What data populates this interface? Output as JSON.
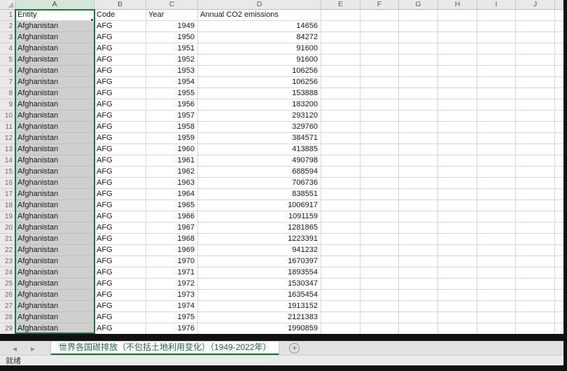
{
  "sheet": {
    "column_letters": [
      "A",
      "B",
      "C",
      "D",
      "E",
      "F",
      "G",
      "H",
      "I",
      "J"
    ],
    "header_row": {
      "entity": "Entity",
      "code": "Code",
      "year": "Year",
      "emissions": "Annual CO2 emissions"
    },
    "rows": [
      {
        "entity": "Afghanistan",
        "code": "AFG",
        "year": "1949",
        "value": "14656"
      },
      {
        "entity": "Afghanistan",
        "code": "AFG",
        "year": "1950",
        "value": "84272"
      },
      {
        "entity": "Afghanistan",
        "code": "AFG",
        "year": "1951",
        "value": "91600"
      },
      {
        "entity": "Afghanistan",
        "code": "AFG",
        "year": "1952",
        "value": "91600"
      },
      {
        "entity": "Afghanistan",
        "code": "AFG",
        "year": "1953",
        "value": "106256"
      },
      {
        "entity": "Afghanistan",
        "code": "AFG",
        "year": "1954",
        "value": "106256"
      },
      {
        "entity": "Afghanistan",
        "code": "AFG",
        "year": "1955",
        "value": "153888"
      },
      {
        "entity": "Afghanistan",
        "code": "AFG",
        "year": "1956",
        "value": "183200"
      },
      {
        "entity": "Afghanistan",
        "code": "AFG",
        "year": "1957",
        "value": "293120"
      },
      {
        "entity": "Afghanistan",
        "code": "AFG",
        "year": "1958",
        "value": "329760"
      },
      {
        "entity": "Afghanistan",
        "code": "AFG",
        "year": "1959",
        "value": "384571"
      },
      {
        "entity": "Afghanistan",
        "code": "AFG",
        "year": "1960",
        "value": "413885"
      },
      {
        "entity": "Afghanistan",
        "code": "AFG",
        "year": "1961",
        "value": "490798"
      },
      {
        "entity": "Afghanistan",
        "code": "AFG",
        "year": "1962",
        "value": "688594"
      },
      {
        "entity": "Afghanistan",
        "code": "AFG",
        "year": "1963",
        "value": "706736"
      },
      {
        "entity": "Afghanistan",
        "code": "AFG",
        "year": "1964",
        "value": "838551"
      },
      {
        "entity": "Afghanistan",
        "code": "AFG",
        "year": "1965",
        "value": "1006917"
      },
      {
        "entity": "Afghanistan",
        "code": "AFG",
        "year": "1966",
        "value": "1091159"
      },
      {
        "entity": "Afghanistan",
        "code": "AFG",
        "year": "1967",
        "value": "1281865"
      },
      {
        "entity": "Afghanistan",
        "code": "AFG",
        "year": "1968",
        "value": "1223391"
      },
      {
        "entity": "Afghanistan",
        "code": "AFG",
        "year": "1969",
        "value": "941232"
      },
      {
        "entity": "Afghanistan",
        "code": "AFG",
        "year": "1970",
        "value": "1670397"
      },
      {
        "entity": "Afghanistan",
        "code": "AFG",
        "year": "1971",
        "value": "1893554"
      },
      {
        "entity": "Afghanistan",
        "code": "AFG",
        "year": "1972",
        "value": "1530347"
      },
      {
        "entity": "Afghanistan",
        "code": "AFG",
        "year": "1973",
        "value": "1635454"
      },
      {
        "entity": "Afghanistan",
        "code": "AFG",
        "year": "1974",
        "value": "1913152"
      },
      {
        "entity": "Afghanistan",
        "code": "AFG",
        "year": "1975",
        "value": "2121383"
      },
      {
        "entity": "Afghanistan",
        "code": "AFG",
        "year": "1976",
        "value": "1990859"
      }
    ]
  },
  "tab_bar": {
    "prev_icon": "◂",
    "next_icon": "▸",
    "sheet_tab_label": "世界各国碳排放（不包括土地利用变化）（1949-2022年）",
    "new_sheet_icon": "+"
  },
  "status_bar": {
    "ready_text": "就绪"
  },
  "colors": {
    "accent_green": "#1e7145",
    "selected_column_fill": "#cfcfcf",
    "selected_header_fill": "#d3e5d6",
    "header_fill": "#e9e9e9",
    "gridline": "#d6d6d6"
  }
}
